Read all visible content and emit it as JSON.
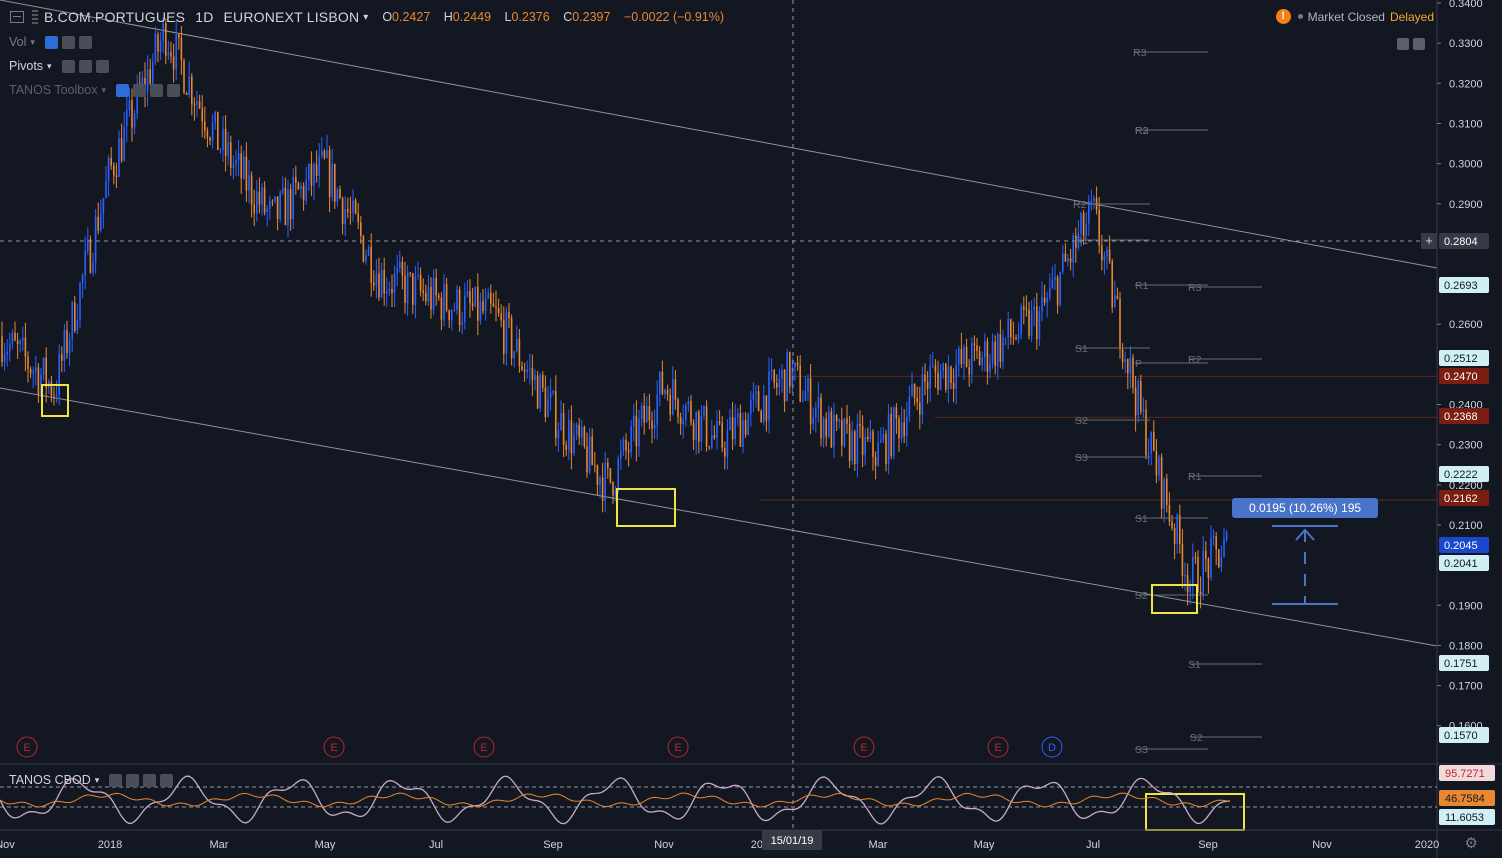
{
  "header": {
    "symbol": "B.COM.PORTUGUES",
    "interval": "1D",
    "exchange": "EURONEXT LISBON",
    "open_label": "O",
    "open": "0.2427",
    "high_label": "H",
    "high": "0.2449",
    "low_label": "L",
    "low": "0.2376",
    "close_label": "C",
    "close": "0.2397",
    "change": "−0.0022 (−0.91%)"
  },
  "status": {
    "market": "Market Closed",
    "delayed": "Delayed"
  },
  "legends": {
    "vol": "Vol",
    "pivots": "Pivots",
    "toolbox": "TANOS Toolbox",
    "cbod": "TANOS CBOD"
  },
  "crosshair": {
    "price": "0.2804",
    "date": "15/01/19"
  },
  "measure": {
    "label": "0.0195 (10.26%) 195"
  },
  "colors": {
    "bg": "#131722",
    "up": "#2962ff",
    "down": "#e8882f",
    "highlight": "#f0e442",
    "grid": "#2a2e39"
  },
  "chart_data": [
    {
      "type": "candlestick",
      "title": "B.COM.PORTUGUES · 1D · EURONEXT LISBON",
      "x_ticks": [
        "Nov",
        "2018",
        "Mar",
        "May",
        "Jul",
        "Sep",
        "Nov",
        "2019",
        "Mar",
        "May",
        "Jul",
        "Sep",
        "Nov",
        "2020"
      ],
      "y_ticks": [
        "0.3400",
        "0.3300",
        "0.3200",
        "0.3100",
        "0.3000",
        "0.2900",
        "0.2600",
        "0.2400",
        "0.2300",
        "0.2200",
        "0.2100",
        "0.1900",
        "0.1800",
        "0.1700",
        "0.1600"
      ],
      "ylim": [
        0.155,
        0.345
      ],
      "price_labels": [
        {
          "value": "0.2804",
          "kind": "crosshair"
        },
        {
          "value": "0.2693",
          "kind": "pivot"
        },
        {
          "value": "0.2512",
          "kind": "pivot"
        },
        {
          "value": "0.2470",
          "kind": "level"
        },
        {
          "value": "0.2368",
          "kind": "level"
        },
        {
          "value": "0.2222",
          "kind": "pivot"
        },
        {
          "value": "0.2162",
          "kind": "level"
        },
        {
          "value": "0.2045",
          "kind": "last"
        },
        {
          "value": "0.2041",
          "kind": "pivot"
        },
        {
          "value": "0.1751",
          "kind": "pivot"
        },
        {
          "value": "0.1570",
          "kind": "pivot"
        }
      ],
      "close_path": [
        [
          "Nov 2017",
          0.257
        ],
        [
          "Dec 2017",
          0.244
        ],
        [
          "Jan 2018",
          0.298
        ],
        [
          "Feb 2018",
          0.333
        ],
        [
          "Mar 2018",
          0.305
        ],
        [
          "Apr 2018",
          0.286
        ],
        [
          "May 2018",
          0.299
        ],
        [
          "Jun 2018",
          0.272
        ],
        [
          "Jul 2018",
          0.266
        ],
        [
          "Aug 2018",
          0.262
        ],
        [
          "Sep 2018",
          0.238
        ],
        [
          "Oct 2018",
          0.22
        ],
        [
          "Nov 2018",
          0.245
        ],
        [
          "Dec 2018",
          0.23
        ],
        [
          "Jan 2019",
          0.248
        ],
        [
          "Feb 2019",
          0.232
        ],
        [
          "Mar 2019",
          0.228
        ],
        [
          "Apr 2019",
          0.247
        ],
        [
          "May 2019",
          0.252
        ],
        [
          "Jun 2019",
          0.262
        ],
        [
          "Jul 2019",
          0.288
        ],
        [
          "Aug 2019",
          0.238
        ],
        [
          "Sep 2019",
          0.196
        ],
        [
          "Sep 2019 end",
          0.2045
        ]
      ],
      "pivot_levels": [
        {
          "label": "R3",
          "value": 0.3276
        },
        {
          "label": "R3",
          "value": 0.3096
        },
        {
          "label": "R2",
          "value": 0.3096
        },
        {
          "label": "R2",
          "value": 0.2896
        },
        {
          "label": "R1",
          "value": 0.2808
        },
        {
          "label": "R1",
          "value": 0.2693
        },
        {
          "label": "R3",
          "value": 0.2693
        },
        {
          "label": "P",
          "value": 0.2578
        },
        {
          "label": "S1",
          "value": 0.26
        },
        {
          "label": "R2",
          "value": 0.2512
        },
        {
          "label": "S2",
          "value": 0.237
        },
        {
          "label": "S3",
          "value": 0.232
        },
        {
          "label": "R1",
          "value": 0.2222
        },
        {
          "label": "S1",
          "value": 0.2041
        },
        {
          "label": "S2",
          "value": 0.1912
        },
        {
          "label": "S1",
          "value": 0.1751
        },
        {
          "label": "S2",
          "value": 0.157
        },
        {
          "label": "S3",
          "value": 0.155
        }
      ],
      "event_markers": [
        "E",
        "E",
        "E",
        "E",
        "E",
        "E",
        "D"
      ]
    },
    {
      "type": "line",
      "title": "TANOS CBOD",
      "y_labels": [
        "95.7271",
        "46.7584",
        "11.6053"
      ]
    }
  ]
}
